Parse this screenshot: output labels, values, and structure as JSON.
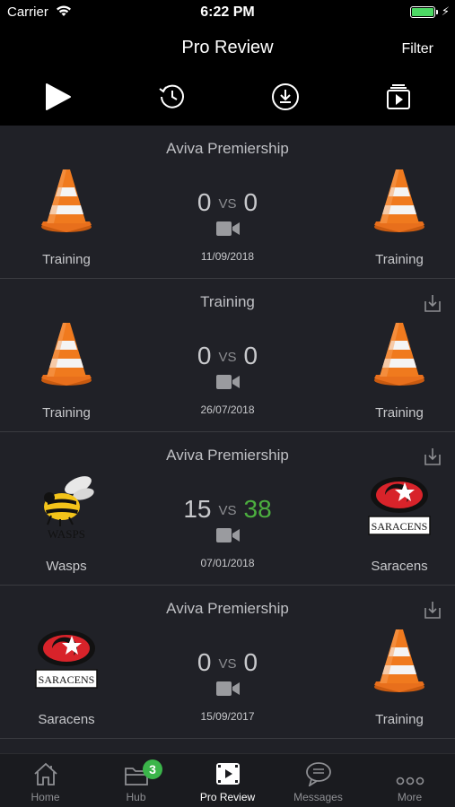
{
  "status": {
    "carrier": "Carrier",
    "time": "6:22 PM"
  },
  "nav": {
    "title": "Pro Review",
    "filter": "Filter"
  },
  "toolbar": [
    "play-icon",
    "history-icon",
    "download-icon",
    "playlist-icon"
  ],
  "matches": [
    {
      "league": "Aviva Premiership",
      "home": "Training",
      "away": "Training",
      "home_score": "0",
      "away_score": "0",
      "vs": "VS",
      "date": "11/09/2018",
      "download": false
    },
    {
      "league": "Training",
      "home": "Training",
      "away": "Training",
      "home_score": "0",
      "away_score": "0",
      "vs": "VS",
      "date": "26/07/2018",
      "download": true
    },
    {
      "league": "Aviva Premiership",
      "home": "Wasps",
      "away": "Saracens",
      "home_score": "15",
      "away_score": "38",
      "vs": "VS",
      "date": "07/01/2018",
      "download": true
    },
    {
      "league": "Aviva Premiership",
      "home": "Saracens",
      "away": "Training",
      "home_score": "0",
      "away_score": "0",
      "vs": "VS",
      "date": "15/09/2017",
      "download": true
    }
  ],
  "logos": {
    "wasps_text": "WASPS",
    "saracens_text": "SARACENS"
  },
  "colors": {
    "win": "#4caf3f",
    "badge": "#3bb54a",
    "cone": "#f07a1e"
  },
  "tabs": [
    {
      "label": "Home"
    },
    {
      "label": "Hub",
      "badge": "3"
    },
    {
      "label": "Pro Review"
    },
    {
      "label": "Messages"
    },
    {
      "label": "More"
    }
  ]
}
